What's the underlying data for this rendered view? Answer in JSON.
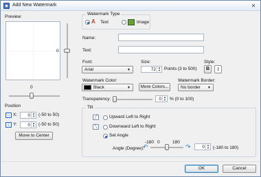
{
  "window": {
    "title": "Add New Watermark",
    "close_glyph": "✕"
  },
  "preview": {
    "label": "Preview:",
    "v_slider_value": "0",
    "h_slider_value": "0"
  },
  "position": {
    "label": "Position",
    "x_label": "X:",
    "x_value": "0",
    "x_range": "(-50 to 50)",
    "y_label": "Y:",
    "y_value": "0",
    "y_range": "(-50 to 50)",
    "center_button": "Move to Center"
  },
  "type": {
    "label": "Watermark Type",
    "text_option": "Text",
    "image_option": "Image",
    "selected": "Text"
  },
  "name": {
    "label": "Name:",
    "value": ""
  },
  "text": {
    "label": "Text:",
    "value": ""
  },
  "font": {
    "label": "Font:",
    "value": "Arial"
  },
  "size": {
    "label": "Size:",
    "value": "72",
    "suffix": "Points (3 to 500)"
  },
  "style": {
    "label": "Style:",
    "bold": "B",
    "italic": "I"
  },
  "color": {
    "label": "Watermark Color:",
    "value": "Black",
    "swatch": "#000000",
    "more_button": "More Colors..."
  },
  "border": {
    "label": "Watermark Border:",
    "value": "No border"
  },
  "transparency": {
    "label": "Transparency:",
    "value": "0",
    "suffix": "% (0 to 100)"
  },
  "tilt": {
    "label": "Tilt",
    "up": "Upward Left to Right",
    "down": "Downward Left to Right",
    "set": "Set Angle",
    "selected": "Set Angle",
    "angle_label": "Angle (Degree):",
    "min": "-180",
    "mid": "0",
    "max": "180",
    "angle_value": "0",
    "angle_range": "(-180 to 180)"
  },
  "footer": {
    "ok": "OK",
    "cancel": "Cancel"
  },
  "accent": "#1c58b8"
}
